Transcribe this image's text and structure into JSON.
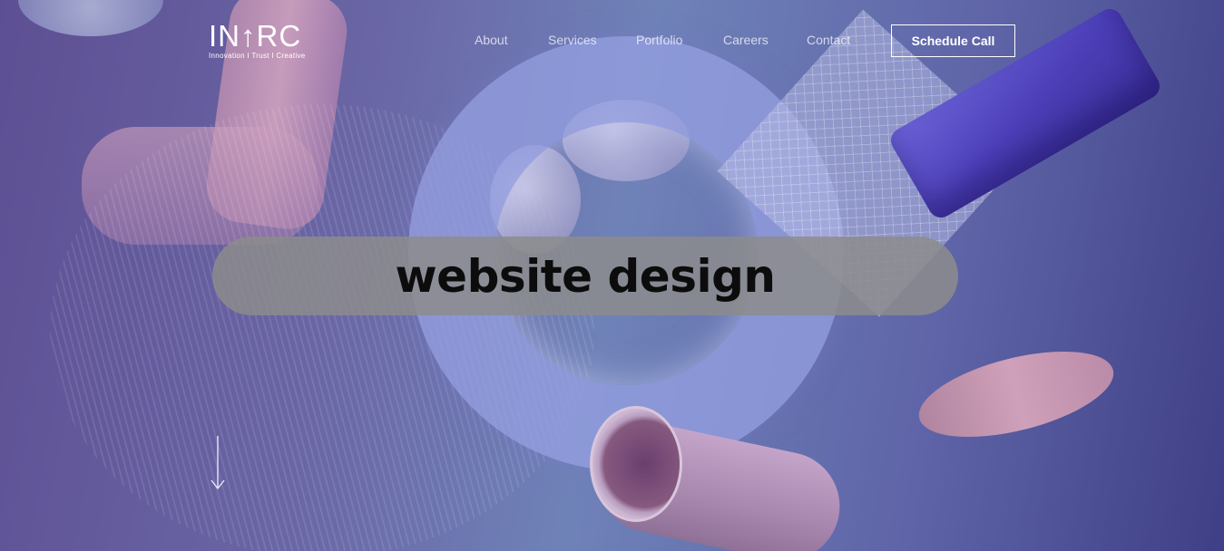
{
  "brand": {
    "logo_text": "IN↑RC",
    "tagline": "Innovation I Trust I Creative"
  },
  "nav": {
    "items": [
      {
        "label": "About"
      },
      {
        "label": "Services"
      },
      {
        "label": "Portfolio"
      },
      {
        "label": "Careers"
      },
      {
        "label": "Contact"
      }
    ],
    "cta_label": "Schedule Call"
  },
  "hero": {
    "headline": "website design"
  },
  "icons": {
    "scroll": "arrow-down-icon"
  },
  "colors": {
    "background_start": "#5d4f93",
    "background_end": "#3f3f86",
    "pill": "#8c8c8c",
    "headline": "#0c0c0c",
    "nav_text": "#ffffff"
  }
}
